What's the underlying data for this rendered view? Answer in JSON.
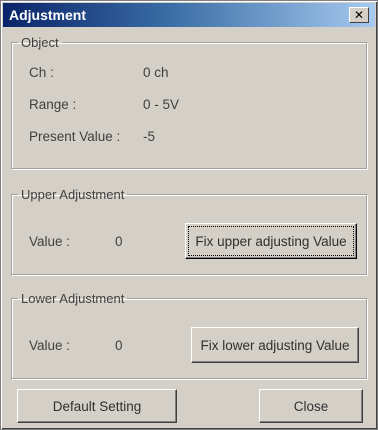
{
  "window": {
    "title": "Adjustment",
    "close_glyph": "✕"
  },
  "object": {
    "legend": "Object",
    "ch_label": "Ch :",
    "ch_value": "0 ch",
    "range_label": "Range :",
    "range_value": "0 - 5V",
    "present_label": "Present Value :",
    "present_value": "-5"
  },
  "upper": {
    "legend": "Upper Adjustment",
    "value_label": "Value :",
    "value": "0",
    "fix_button": "Fix upper adjusting Value"
  },
  "lower": {
    "legend": "Lower Adjustment",
    "value_label": "Value :",
    "value": "0",
    "fix_button": "Fix lower adjusting Value"
  },
  "footer": {
    "default_button": "Default Setting",
    "close_button": "Close"
  }
}
